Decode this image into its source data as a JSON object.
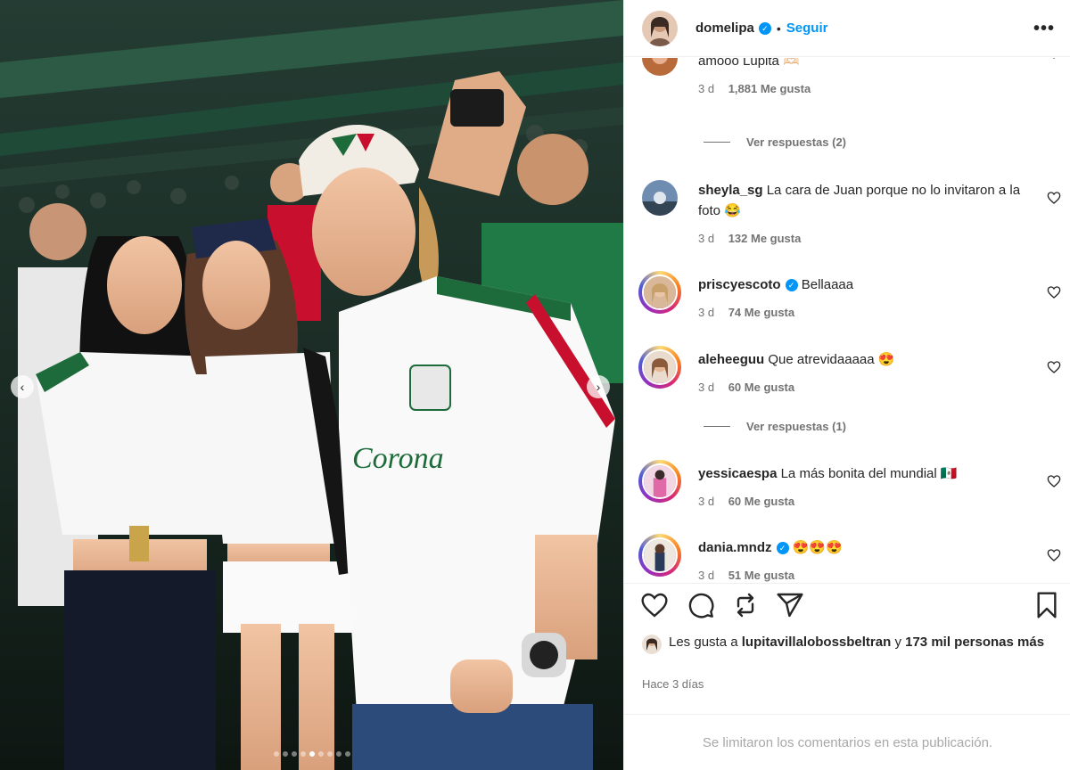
{
  "post": {
    "username": "domelipa",
    "follow_label": "Seguir",
    "separator": "•",
    "more_label": "•••",
    "verified_icon": "✓"
  },
  "comments": [
    {
      "username": "",
      "text": "amooo Lupita 🫶🏻",
      "time": "3 d",
      "likes": "1,881 Me gusta",
      "replies": "Ver respuestas (2)"
    },
    {
      "username": "sheyla_sg",
      "text": "La cara de Juan porque no lo invitaron a la foto 😂",
      "time": "3 d",
      "likes": "132 Me gusta"
    },
    {
      "username": "priscyescoto",
      "text": "Bellaaaa",
      "time": "3 d",
      "likes": "74 Me gusta",
      "verified": true
    },
    {
      "username": "aleheeguu",
      "text": "Que atrevidaaaaa 😍",
      "time": "3 d",
      "likes": "60 Me gusta",
      "replies": "Ver respuestas (1)"
    },
    {
      "username": "yessicaespa",
      "text": "La más bonita del mundial 🇲🇽",
      "time": "3 d",
      "likes": "60 Me gusta"
    },
    {
      "username": "dania.mndz",
      "text": "😍😍😍",
      "time": "3 d",
      "likes": "51 Me gusta",
      "verified": true
    }
  ],
  "likes_bar": {
    "prefix": "Les gusta a",
    "user": "lupitavillalobossbeltran",
    "middle": "y",
    "count": "173 mil personas",
    "suffix": "más"
  },
  "date": "Hace 3 días",
  "footer": "Se limitaron los comentarios en esta publicación.",
  "carousel": {
    "prev_icon": "‹",
    "next_icon": "›",
    "active_index": 4,
    "total": 9
  },
  "colors": {
    "accent": "#0095f6",
    "muted": "#737373",
    "border": "#efefef",
    "mexico_green": "#1d6b3a",
    "mexico_red": "#c8102e"
  },
  "icons": [
    "heart-icon",
    "comment-icon",
    "repost-icon",
    "share-icon",
    "bookmark-icon",
    "more-icon",
    "verified-icon"
  ]
}
